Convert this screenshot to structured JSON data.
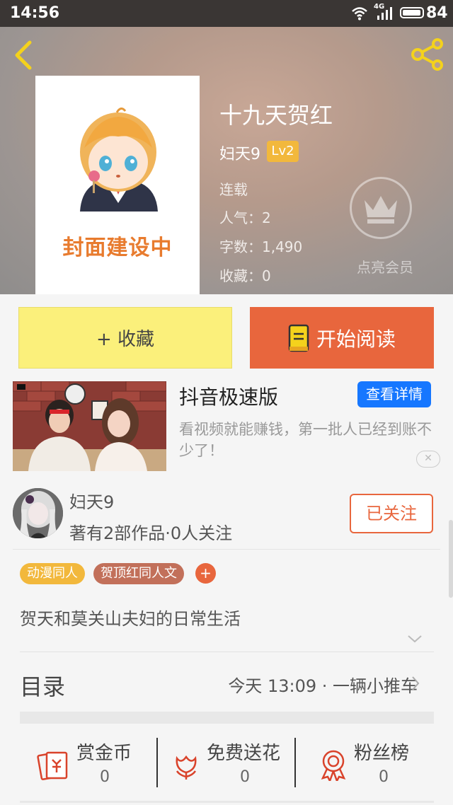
{
  "status_bar": {
    "time": "14:56",
    "network": "4G",
    "battery": "84"
  },
  "header": {
    "cover_text": "封面建设中",
    "title": "十九天贺红",
    "author": "妇天9",
    "level": "Lv2",
    "status": "连载",
    "popularity": "人气：2",
    "word_count": "字数：1,490",
    "favorites": "收藏：0",
    "vip_label": "点亮会员"
  },
  "actions": {
    "favorite": "+ 收藏",
    "read": "开始阅读"
  },
  "ad": {
    "title": "抖音极速版",
    "detail_button": "查看详情",
    "description": "看视频就能赚钱，第一批人已经到账不少了！"
  },
  "author_card": {
    "name": "妇天9",
    "works": "著有2部作品·0人关注",
    "follow_button": "已关注"
  },
  "tags": [
    "动漫同人",
    "贺顶红同人文"
  ],
  "tag_add": "+",
  "description": "贺天和莫关山夫妇的日常生活",
  "toc": {
    "label": "目录",
    "latest": "今天 13:09 · 一辆小推车"
  },
  "bottom": [
    {
      "label": "赏金币",
      "count": "0"
    },
    {
      "label": "免费送花",
      "count": "0"
    },
    {
      "label": "粉丝榜",
      "count": "0"
    }
  ],
  "colors": {
    "accent": "#e8663d",
    "favorite_bg": "#fbf07b",
    "level_badge": "#f2b83c",
    "ad_button": "#1677ff"
  }
}
